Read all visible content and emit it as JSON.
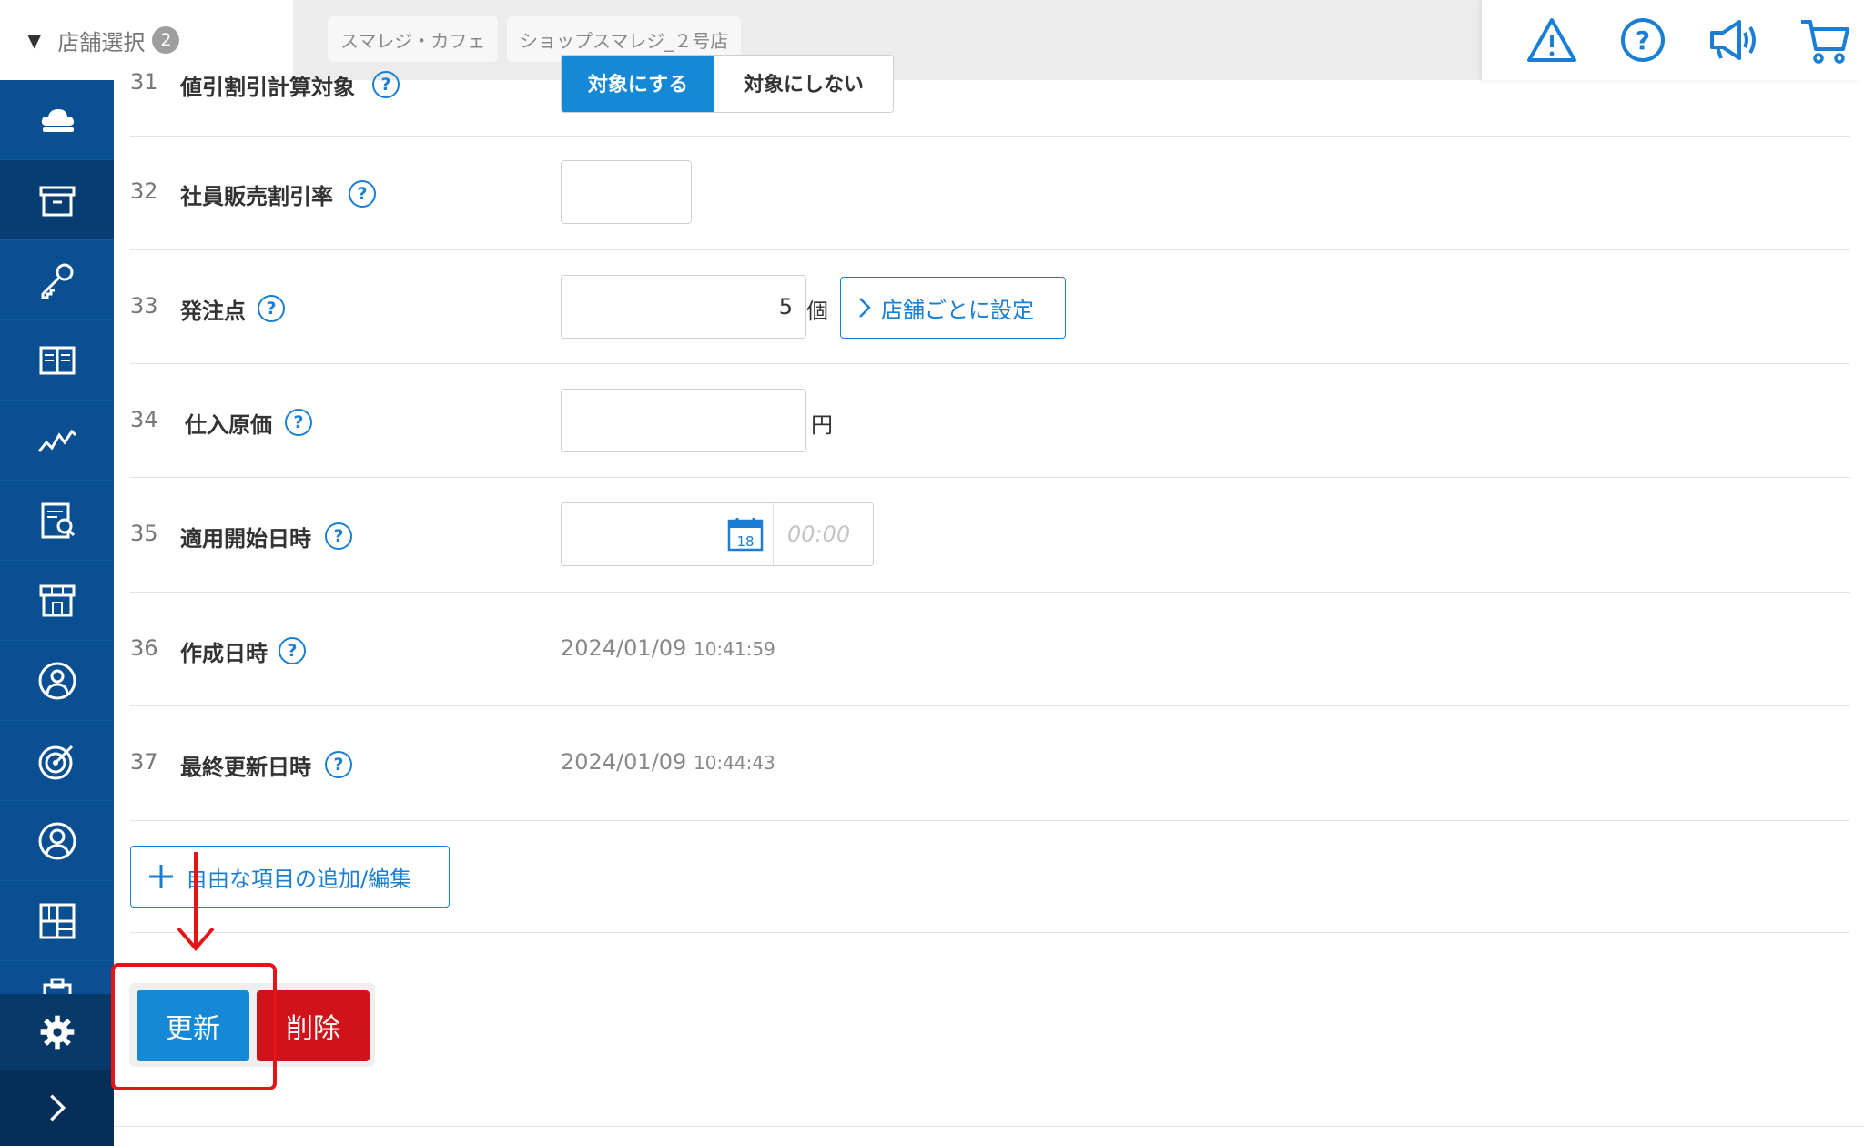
{
  "header": {
    "store_select_label": "店舗選択",
    "store_count": "2",
    "stores": [
      "スマレジ・カフェ",
      "ショップスマレジ_２号店"
    ],
    "icons": [
      "warning-icon",
      "help-icon",
      "megaphone-icon",
      "cart-icon"
    ]
  },
  "sidebar": {
    "items": [
      "cloud-icon",
      "archive-icon",
      "key-icon",
      "book-icon",
      "chart-icon",
      "report-icon",
      "store-icon",
      "user-icon",
      "target-icon",
      "member-icon",
      "grid-icon",
      "clipboard-icon"
    ],
    "active_index": 1,
    "bottom": [
      "gear-icon",
      "chevron-right-icon"
    ]
  },
  "rows": {
    "r31": {
      "num": "31",
      "label": "値引割引計算対象",
      "on": "対象にする",
      "off": "対象にしない"
    },
    "r32": {
      "num": "32",
      "label": "社員販売割引率",
      "value": ""
    },
    "r33": {
      "num": "33",
      "label": "発注点",
      "value": "5",
      "unit": "個",
      "button": "店舗ごとに設定"
    },
    "r34": {
      "num": "34",
      "label": "仕入原価",
      "value": "",
      "unit": "円"
    },
    "r35": {
      "num": "35",
      "label": "適用開始日時",
      "calendar_day": "18",
      "time_placeholder": "00:00"
    },
    "r36": {
      "num": "36",
      "label": "作成日時",
      "date": "2024/01/09",
      "time": "10:41:59"
    },
    "r37": {
      "num": "37",
      "label": "最終更新日時",
      "date": "2024/01/09",
      "time": "10:44:43"
    }
  },
  "add_field_button": "自由な項目の追加/編集",
  "actions": {
    "update": "更新",
    "delete": "削除"
  },
  "colors": {
    "primary": "#1589d6",
    "danger": "#d0121b",
    "sidebar": "#0a4f92",
    "highlight": "#e5141b"
  }
}
